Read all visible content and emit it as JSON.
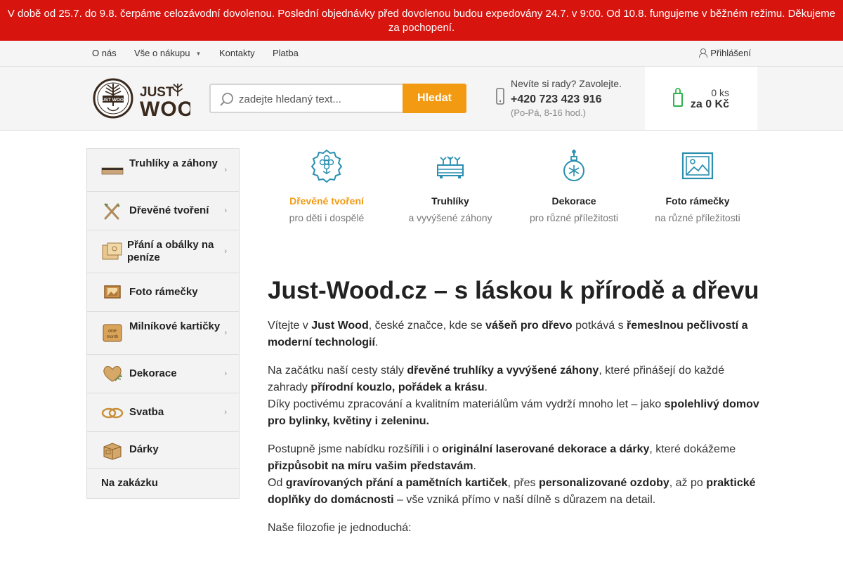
{
  "notice": {
    "text": "V době od 25.7. do 9.8. čerpáme celozávodní dovolenou. Poslední objednávky před dovolenou budou expedovány 24.7. v 9:00. Od 10.8. fungujeme v běžném režimu. Děkujeme za pochopení."
  },
  "topnav": {
    "links": [
      "O nás",
      "Vše o nákupu",
      "Kontakty",
      "Platba"
    ],
    "login": "Přihlášení"
  },
  "header": {
    "logo_text": [
      "JUST",
      "WOOD"
    ],
    "search_placeholder": "zadejte hledaný text...",
    "search_button": "Hledat",
    "contact_question": "Nevíte si rady? Zavolejte.",
    "contact_phone": "+420 723 423 916",
    "contact_hours": "(Po-Pá, 8-16 hod.)",
    "cart_count": "0 ks",
    "cart_total": "za 0 Kč"
  },
  "sidebar": {
    "categories": [
      {
        "label": "Truhlíky a záhony",
        "icon": "planter-icon",
        "has_submenu": true
      },
      {
        "label": "Dřevěné tvoření",
        "icon": "tools-icon",
        "has_submenu": true
      },
      {
        "label": "Přání a obálky na peníze",
        "icon": "envelope-icon",
        "has_submenu": true
      },
      {
        "label": "Foto rámečky",
        "icon": "photo-frame-icon",
        "has_submenu": false
      },
      {
        "label": "Milníkové kartičky",
        "icon": "milestone-card-icon",
        "has_submenu": true
      },
      {
        "label": "Dekorace",
        "icon": "heart-decoration-icon",
        "has_submenu": true
      },
      {
        "label": "Svatba",
        "icon": "rings-icon",
        "has_submenu": true
      },
      {
        "label": "Dárky",
        "icon": "gift-box-icon",
        "has_submenu": false
      },
      {
        "label": "Na zakázku",
        "icon": "",
        "has_submenu": false
      }
    ]
  },
  "features": [
    {
      "title": "Dřevěné tvoření",
      "subtitle": "pro děti i dospělé",
      "icon": "flower-badge-icon",
      "active": true
    },
    {
      "title": "Truhlíky",
      "subtitle": "a vyvýšené záhony",
      "icon": "planter-outline-icon",
      "active": false
    },
    {
      "title": "Dekorace",
      "subtitle": "pro různé příležitosti",
      "icon": "ornament-icon",
      "active": false
    },
    {
      "title": "Foto rámečky",
      "subtitle": "na různé příležitosti",
      "icon": "image-frame-icon",
      "active": false
    }
  ],
  "colors": {
    "accent": "#f39a13",
    "notice_bg": "#d8140f",
    "cart_green": "#2fb34a",
    "icon_teal": "#2a8fb0"
  },
  "content": {
    "heading": " Just-Wood.cz – s láskou k přírodě a dřevu ",
    "p1": [
      "Vítejte v ",
      "Just Wood",
      ", české značce, kde se ",
      "vášeň pro dřevo",
      " potkává s ",
      "řemeslnou pečlivostí a moderní technologií",
      "."
    ],
    "p2": [
      "Na začátku naší cesty stály ",
      "dřevěné truhlíky a vyvýšené záhony",
      ", které přinášejí do každé zahrady ",
      "přírodní kouzlo, pořádek a krásu",
      "."
    ],
    "p2b": [
      "Díky poctivému zpracování a kvalitním materiálům vám vydrží mnoho let – jako ",
      "spolehlivý domov pro bylinky, květiny i zeleninu.",
      " "
    ],
    "p3": [
      "Postupně jsme nabídku rozšířili i o ",
      "originální laserované dekorace a dárky",
      ", které dokážeme ",
      "přizpůsobit na míru vašim představám",
      "."
    ],
    "p3b": [
      "Od ",
      "gravírovaných přání a pamětních kartiček",
      ", přes ",
      "personalizované ozdoby",
      ", až po ",
      "praktické doplňky do domácnosti",
      " – vše vzniká přímo v naší dílně s důrazem na detail. "
    ],
    "p4": "Naše filozofie je jednoduchá:"
  }
}
